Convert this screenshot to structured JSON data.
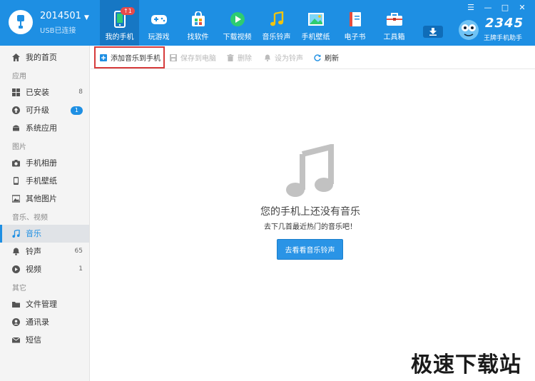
{
  "device": {
    "name": "2014501",
    "status": "USB已连接"
  },
  "nav": {
    "items": [
      {
        "label": "我的手机",
        "badge": "↑1"
      },
      {
        "label": "玩游戏"
      },
      {
        "label": "找软件"
      },
      {
        "label": "下载视频"
      },
      {
        "label": "音乐铃声"
      },
      {
        "label": "手机壁纸"
      },
      {
        "label": "电子书"
      },
      {
        "label": "工具箱"
      }
    ]
  },
  "logo": {
    "number": "2345",
    "subtitle": "王牌手机助手"
  },
  "sidebar": {
    "home": "我的首页",
    "sections": {
      "apps": "应用",
      "pictures": "图片",
      "media": "音乐、视频",
      "other": "其它"
    },
    "items": {
      "installed": {
        "label": "已安装",
        "count": "8"
      },
      "upgradable": {
        "label": "可升级",
        "count": "1"
      },
      "system_apps": {
        "label": "系统应用"
      },
      "album": {
        "label": "手机相册"
      },
      "wallpaper": {
        "label": "手机壁纸"
      },
      "other_pics": {
        "label": "其他图片"
      },
      "music": {
        "label": "音乐"
      },
      "ringtone": {
        "label": "铃声",
        "count": "65"
      },
      "video": {
        "label": "视频",
        "count": "1"
      },
      "files": {
        "label": "文件管理"
      },
      "contacts": {
        "label": "通讯录"
      },
      "sms": {
        "label": "短信"
      }
    }
  },
  "toolbar": {
    "add": "添加音乐到手机",
    "save": "保存到电脑",
    "delete": "删除",
    "set_ringtone": "设为铃声",
    "refresh": "刷新"
  },
  "empty": {
    "title": "您的手机上还没有音乐",
    "subtitle": "去下几首最近热门的音乐吧！",
    "button": "去看看音乐铃声"
  },
  "watermark": "极速下载站",
  "colors": {
    "accent": "#1e8fe3",
    "highlight": "#d63b3b"
  }
}
